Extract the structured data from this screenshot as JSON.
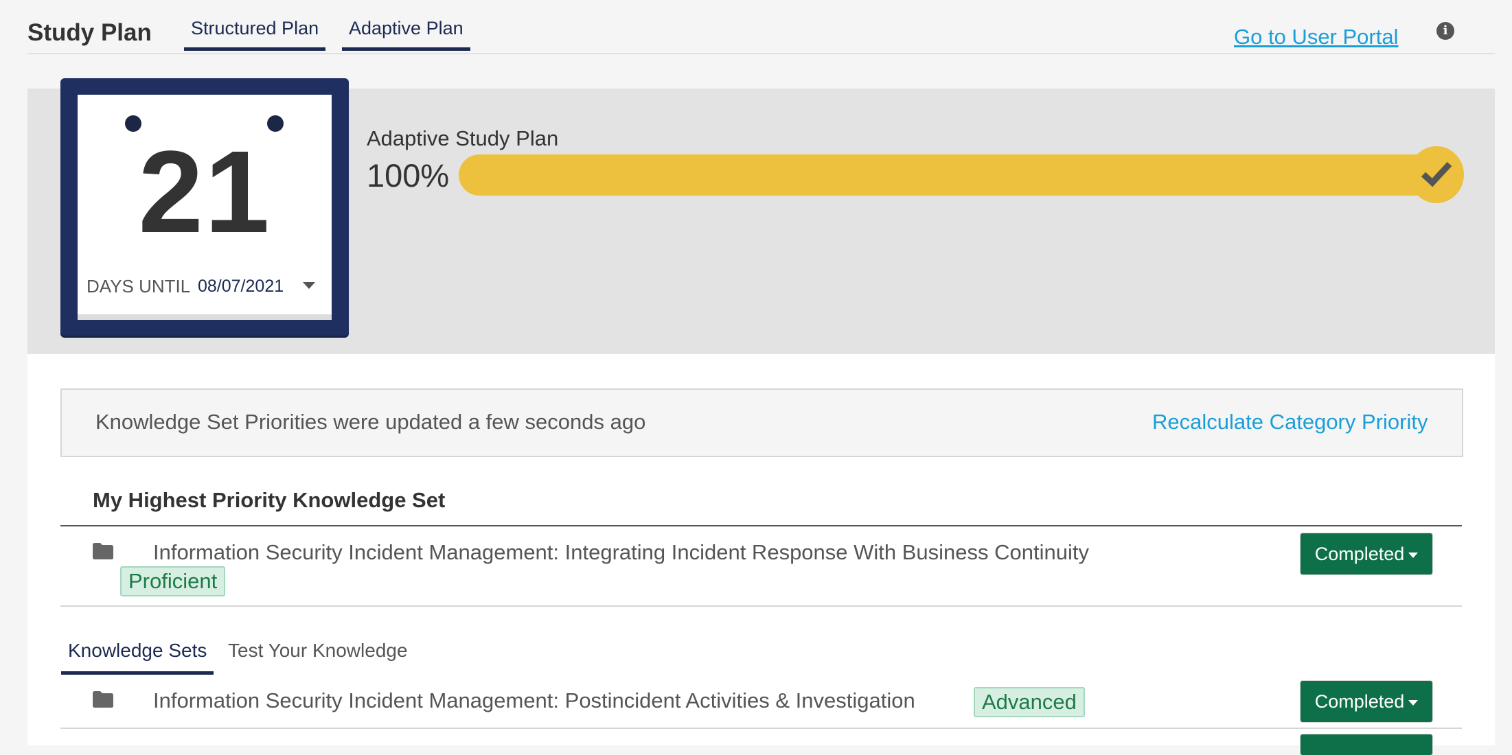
{
  "header": {
    "title": "Study Plan",
    "tabs": [
      {
        "label": "Structured Plan"
      },
      {
        "label": "Adaptive Plan"
      }
    ],
    "portal_link": "Go to User Portal",
    "info_icon": "i"
  },
  "banner": {
    "calendar": {
      "days": "21",
      "until_label": "DAYS UNTIL",
      "date": "08/07/2021"
    },
    "plan": {
      "label": "Adaptive Study Plan",
      "percent_text": "100%",
      "progress": 1.0
    },
    "colors": {
      "calendar_frame": "#1f2f60",
      "progress": "#edc13e"
    }
  },
  "notice": {
    "text": "Knowledge Set Priorities were updated a few seconds ago",
    "action": "Recalculate Category Priority"
  },
  "highest_priority": {
    "heading": "My Highest Priority Knowledge Set",
    "item": {
      "title": "Information Security Incident Management: Integrating Incident Response With Business Continuity",
      "badge": "Proficient",
      "status": "Completed"
    }
  },
  "subtabs": [
    {
      "label": "Knowledge Sets"
    },
    {
      "label": "Test Your Knowledge"
    }
  ],
  "knowledge_sets": [
    {
      "title": "Information Security Incident Management: Postincident Activities & Investigation",
      "badge": "Advanced",
      "status": "Completed"
    }
  ],
  "status_color": "#0d7048",
  "link_color": "#1a9ed8"
}
